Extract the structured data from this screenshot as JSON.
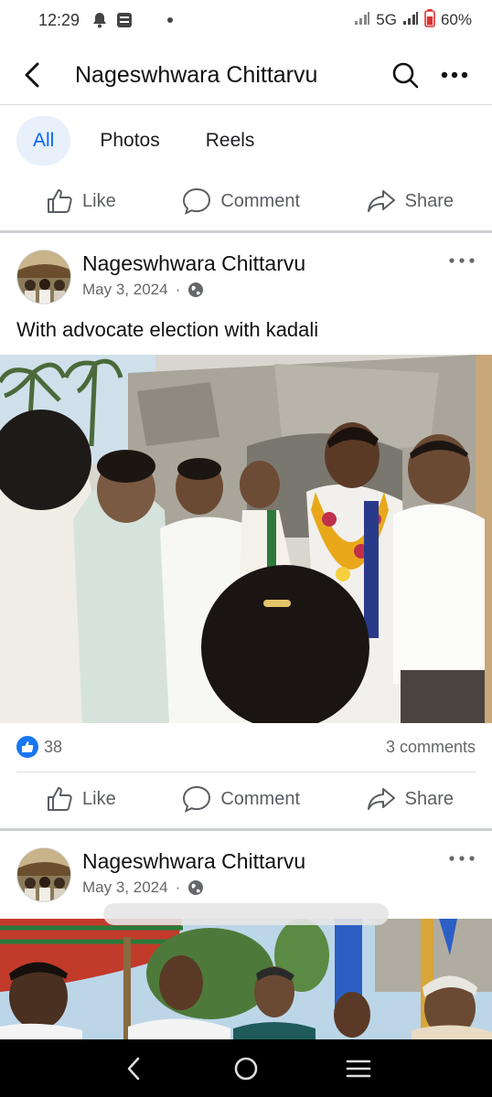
{
  "status": {
    "time": "12:29",
    "network": "5G",
    "battery": "60%",
    "icons": [
      "notification-bell-icon",
      "app-notification-icon",
      "wifi-signal-icon",
      "cell-signal-icon",
      "battery-icon"
    ]
  },
  "header": {
    "title": "Nageswhwara Chittarvu",
    "icons": [
      "back-arrow-icon",
      "search-icon",
      "more-dots-icon"
    ]
  },
  "tabs": [
    {
      "label": "All",
      "active": true
    },
    {
      "label": "Photos",
      "active": false
    },
    {
      "label": "Reels",
      "active": false
    }
  ],
  "actions": {
    "like": "Like",
    "comment": "Comment",
    "share": "Share"
  },
  "posts": [
    {
      "author": "Nageswhwara Chittarvu",
      "date": "May 3, 2024",
      "separator": "·",
      "text": "With advocate election with kadali",
      "reactions": "38",
      "comments": "3 comments"
    },
    {
      "author": "Nageswhwara Chittarvu",
      "date": "May 3, 2024",
      "separator": "·"
    }
  ],
  "colors": {
    "accent": "#0866ff",
    "tab_active_bg": "#e7f0fb",
    "like_blue": "#1877f2",
    "nav_bar": "#000000"
  }
}
